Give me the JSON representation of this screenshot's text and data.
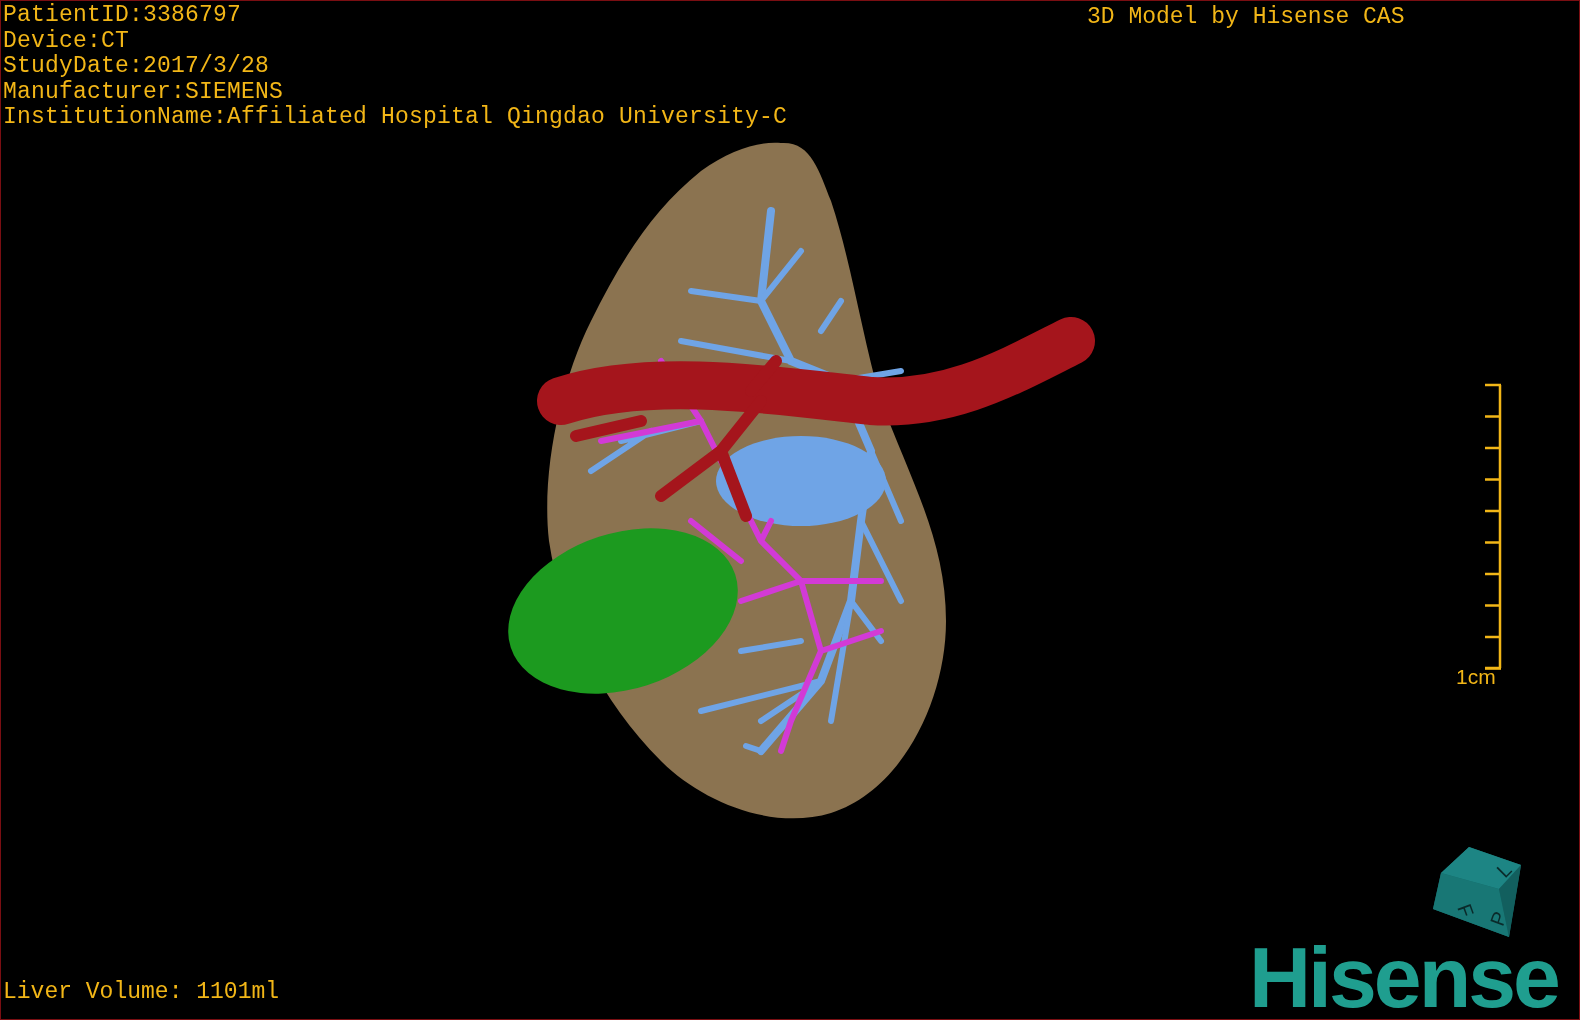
{
  "info_lines": [
    "PatientID:3386797",
    "Device:CT",
    "StudyDate:2017/3/28",
    "Manufacturer:SIEMENS",
    "InstitutionName:Affiliated Hospital Qingdao University-C"
  ],
  "title": "3D Model by Hisense CAS",
  "scale_bar": {
    "label": "1cm"
  },
  "orientation_cube": {
    "faces": [
      "F",
      "L",
      "P"
    ]
  },
  "logo": "Hisense",
  "status": "Liver Volume: 1101ml"
}
